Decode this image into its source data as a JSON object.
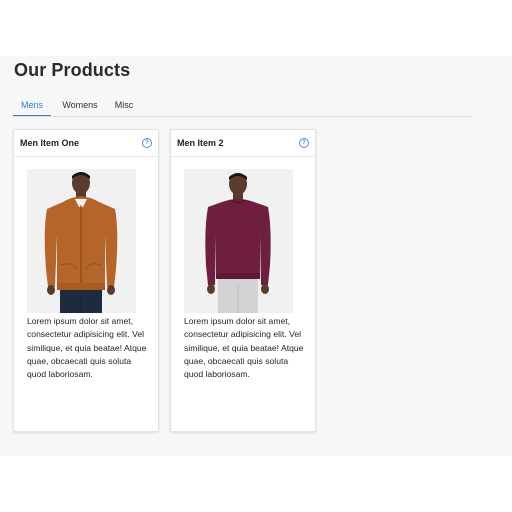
{
  "page": {
    "title": "Our Products"
  },
  "tabs": [
    {
      "label": "Mens",
      "active": true
    },
    {
      "label": "Womens",
      "active": false
    },
    {
      "label": "Misc",
      "active": false
    }
  ],
  "products": [
    {
      "name": "Men Item One",
      "help_icon": "question-circle-icon",
      "image": "man-in-orange-zip-hoodie",
      "description": "Lorem ipsum dolor sit amet, consectetur adipisicing elit. Vel similique, et quia beatae! Atque quae, obcaecati quis soluta quod laboriosam."
    },
    {
      "name": "Men Item 2",
      "help_icon": "question-circle-icon",
      "image": "man-in-maroon-sweater",
      "description": "Lorem ipsum dolor sit amet, consectetur adipisicing elit. Vel similique, et quia beatae! Atque quae, obcaecati quis soluta quod laboriosam."
    }
  ],
  "colors": {
    "accent": "#2f7be0",
    "background": "#f7f7f7",
    "hoodie": "#b5652a",
    "sweater": "#6e1f3e"
  }
}
